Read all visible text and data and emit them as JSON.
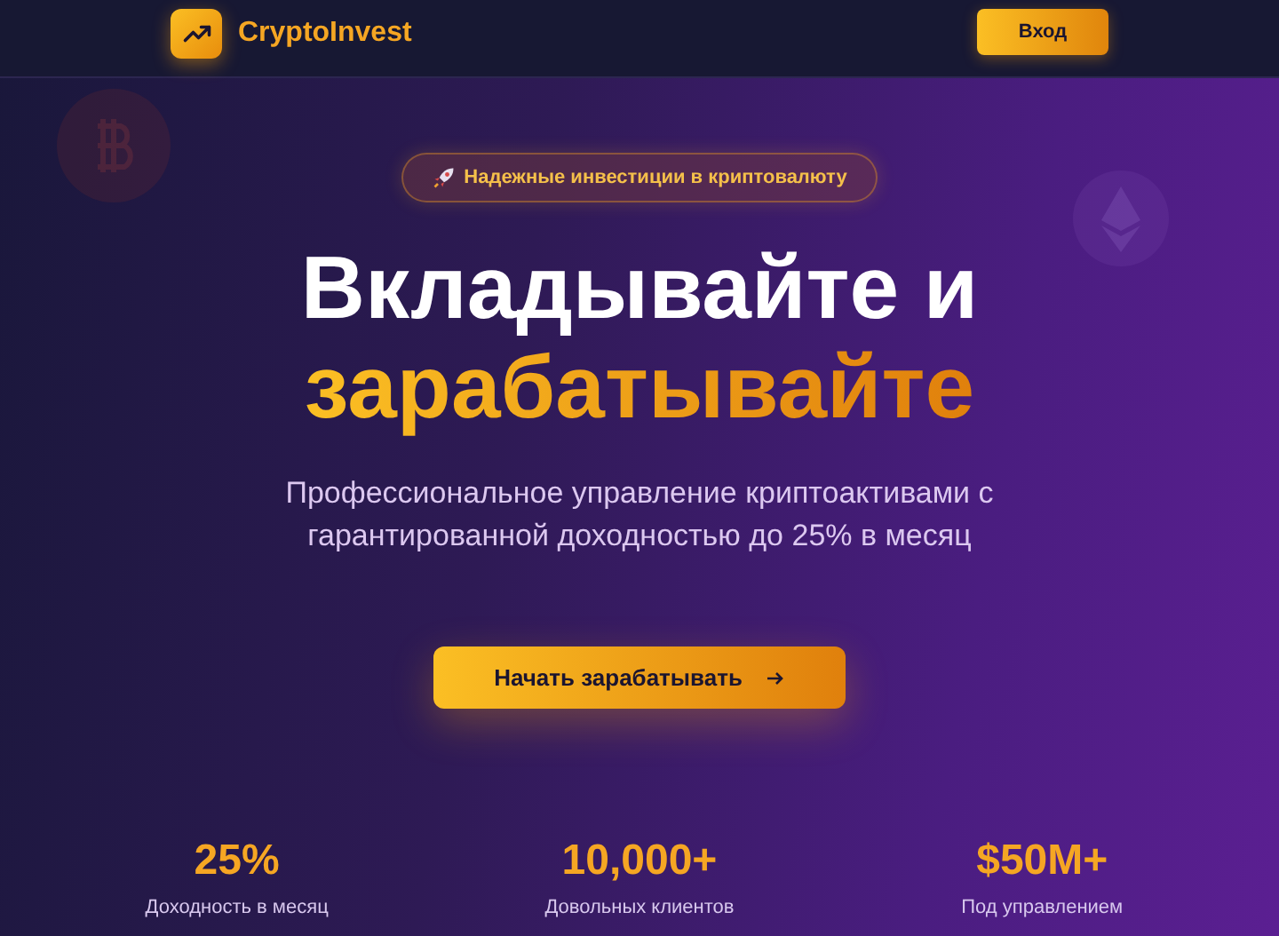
{
  "header": {
    "brand": "CryptoInvest",
    "login_button": "Вход"
  },
  "hero": {
    "badge": "Надежные инвестиции в криптовалюту",
    "title_line1": "Вкладывайте и",
    "title_line2": "зарабатывайте",
    "subtitle": "Профессиональное управление криптоактивами с гарантированной доходностью до 25% в месяц",
    "cta_button": "Начать зарабатывать"
  },
  "stats": [
    {
      "value": "25%",
      "label": "Доходность в месяц"
    },
    {
      "value": "10,000+",
      "label": "Довольных клиентов"
    },
    {
      "value": "$50M+",
      "label": "Под управлением"
    }
  ]
}
